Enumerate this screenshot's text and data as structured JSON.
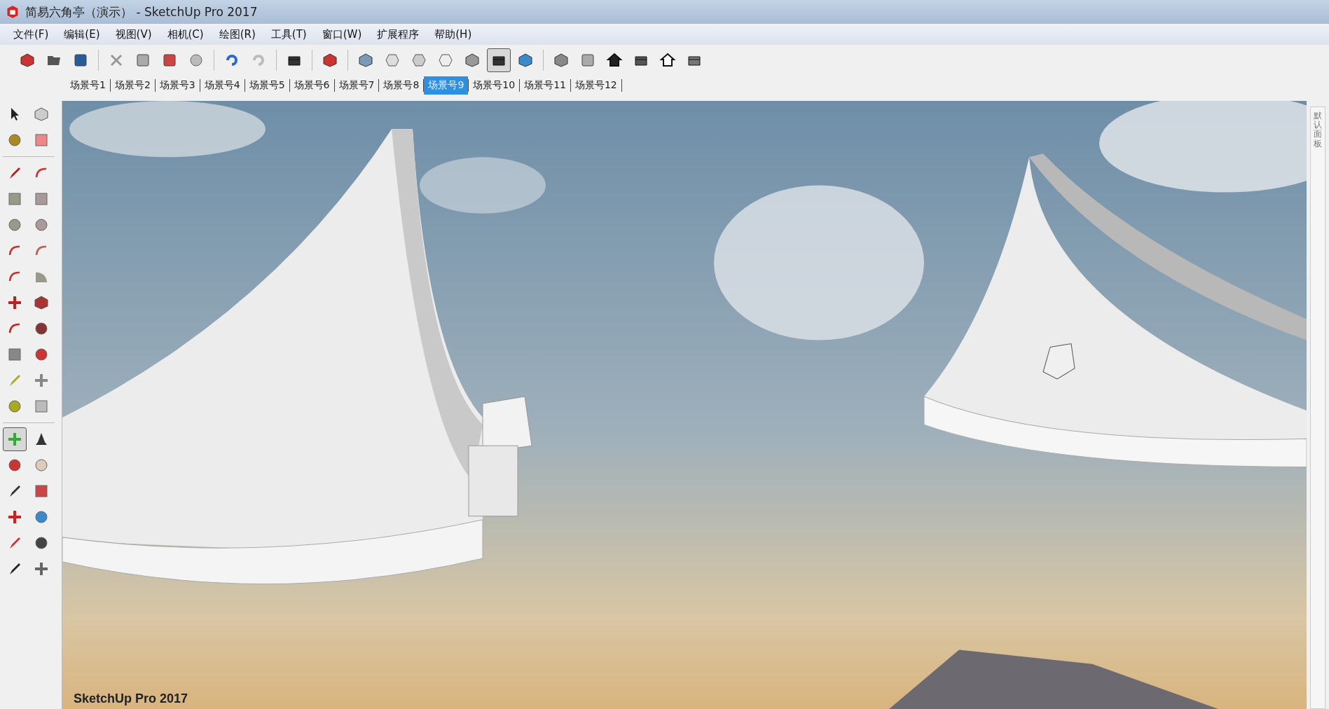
{
  "window": {
    "title": "简易六角亭（演示） - SketchUp Pro 2017"
  },
  "menu": [
    "文件(F)",
    "编辑(E)",
    "视图(V)",
    "相机(C)",
    "绘图(R)",
    "工具(T)",
    "窗口(W)",
    "扩展程序",
    "帮助(H)"
  ],
  "toolbar": [
    {
      "selected": false
    },
    {
      "selected": false
    },
    {
      "selected": false
    },
    {
      "selected": false
    },
    {
      "selected": false
    },
    {
      "selected": false
    },
    {
      "selected": false
    },
    {
      "selected": false
    },
    {
      "selected": false
    },
    {
      "selected": false
    },
    {
      "selected": false
    },
    {
      "selected": false
    },
    {
      "selected": false
    },
    {
      "selected": false
    },
    {
      "selected": false
    },
    {
      "selected": false
    },
    {
      "selected": true
    },
    {
      "selected": false
    },
    {
      "selected": false
    },
    {
      "selected": false
    },
    {
      "selected": false
    },
    {
      "selected": false
    },
    {
      "selected": false
    },
    {
      "selected": false
    }
  ],
  "scenes": [
    {
      "label": "场景号1",
      "selected": false
    },
    {
      "label": "场景号2",
      "selected": false
    },
    {
      "label": "场景号3",
      "selected": false
    },
    {
      "label": "场景号4",
      "selected": false
    },
    {
      "label": "场景号5",
      "selected": false
    },
    {
      "label": "场景号6",
      "selected": false
    },
    {
      "label": "场景号7",
      "selected": false
    },
    {
      "label": "场景号8",
      "selected": false
    },
    {
      "label": "场景号9",
      "selected": true
    },
    {
      "label": "场景号10",
      "selected": false
    },
    {
      "label": "场景号11",
      "selected": false
    },
    {
      "label": "场景号12",
      "selected": false
    }
  ],
  "tools": [
    {
      "selected": false
    },
    {
      "selected": false
    },
    {
      "selected": false
    },
    {
      "selected": false
    },
    {
      "selected": false
    },
    {
      "selected": false
    },
    {
      "selected": false
    },
    {
      "selected": false
    },
    {
      "selected": false
    },
    {
      "selected": false
    },
    {
      "selected": false
    },
    {
      "selected": false
    },
    {
      "selected": false
    },
    {
      "selected": false
    },
    {
      "selected": false
    },
    {
      "selected": false
    },
    {
      "selected": false
    },
    {
      "selected": false
    },
    {
      "selected": false
    },
    {
      "selected": false
    },
    {
      "selected": false
    },
    {
      "selected": false
    },
    {
      "selected": false
    },
    {
      "selected": false
    },
    {
      "selected": true
    },
    {
      "selected": false
    },
    {
      "selected": false
    },
    {
      "selected": false
    },
    {
      "selected": false
    },
    {
      "selected": false
    },
    {
      "selected": false
    },
    {
      "selected": false
    },
    {
      "selected": false
    },
    {
      "selected": false
    },
    {
      "selected": false
    },
    {
      "selected": false
    }
  ],
  "viewport": {
    "label": "SketchUp Pro 2017"
  },
  "tray": {
    "label": "默认面板"
  }
}
